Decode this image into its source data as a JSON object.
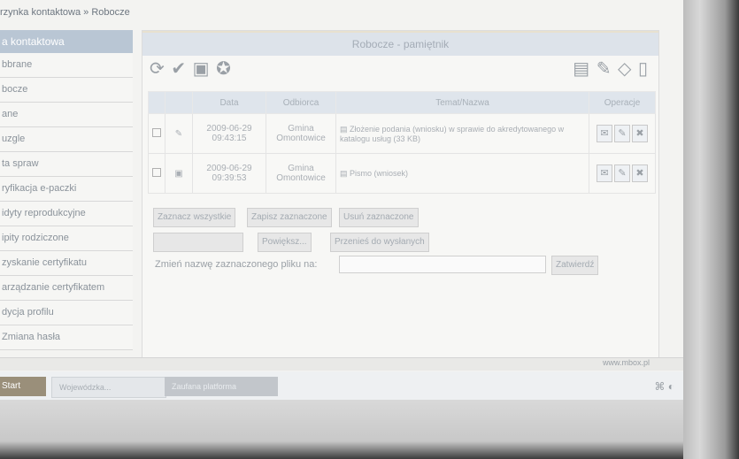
{
  "breadcrumb": "rzynka kontaktowa » Robocze",
  "sidebar": {
    "header": "a kontaktowa",
    "items": [
      {
        "label": "bbrane"
      },
      {
        "label": "bocze"
      },
      {
        "label": "ane"
      },
      {
        "label": "uzgle"
      },
      {
        "label": "ta spraw"
      },
      {
        "label": "ryfikacja e-paczki"
      },
      {
        "label": "idyty reprodukcyjne"
      },
      {
        "label": "ipity rodziczone"
      },
      {
        "label": "zyskanie certyfikatu"
      },
      {
        "label": "arządzanie certyfikatem"
      },
      {
        "label": "dycja profilu"
      },
      {
        "label": "Zmiana hasła"
      }
    ]
  },
  "panel": {
    "title": "Robocze - pamiętnik",
    "columns": [
      "",
      "",
      "Data",
      "Odbiorca",
      "Temat/Nazwa",
      "Operacje"
    ],
    "rows": [
      {
        "date": "2009-06-29",
        "time": "09:43:15",
        "recipient_line1": "Gmina",
        "recipient_line2": "Omontowice",
        "subject": "Złożenie podania (wniosku) w sprawie do akredytowanego w katalogu usług (33 KB)"
      },
      {
        "date": "2009-06-29",
        "time": "09:39:53",
        "recipient_line1": "Gmina",
        "recipient_line2": "Omontowice",
        "subject": "Pismo (wniosek)"
      }
    ],
    "buttons": {
      "select_all": "Zaznacz wszystkie",
      "send_selected": "Zapisz zaznaczone",
      "delete_selected": "Usuń zaznaczone",
      "go_back": "Powiększ...",
      "move_to_sent": "Przenieś do wysłanych"
    },
    "rename_label": "Zmień nazwę zaznaczonego pliku na:",
    "rename_button": "Zatwierdź"
  },
  "statusbar": {
    "url": "www.mbox.pl"
  },
  "taskbar": {
    "start_label": "Start",
    "task1": "Wojewódzka...",
    "task2": "Zaufana platforma"
  },
  "icons": {
    "toolbar_left": [
      "refresh-icon",
      "check-icon",
      "package-icon",
      "certificate-icon"
    ],
    "toolbar_right": [
      "folder-icon",
      "attach-icon",
      "tag-icon",
      "trash-icon"
    ]
  }
}
